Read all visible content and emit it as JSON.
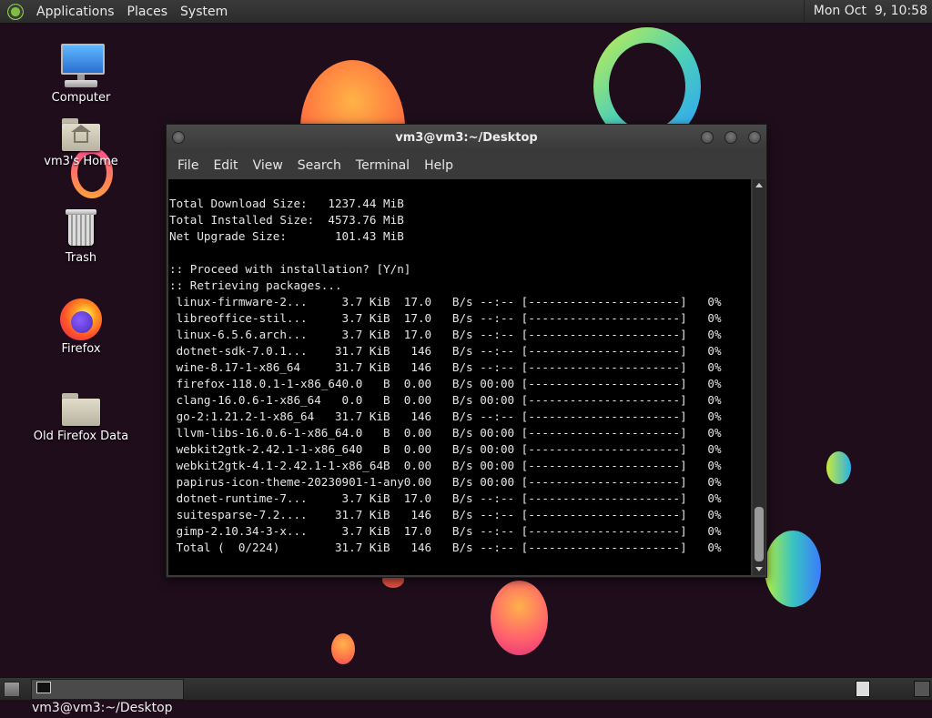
{
  "top_panel": {
    "menus": [
      "Applications",
      "Places",
      "System"
    ],
    "clock": "Mon Oct  9, 10:58",
    "logo_icon": "mate-logo-icon"
  },
  "desktop": {
    "icons": [
      {
        "label": "Computer",
        "icon": "computer-icon"
      },
      {
        "label": "vm3's Home",
        "icon": "home-folder-icon"
      },
      {
        "label": "Trash",
        "icon": "trash-icon"
      },
      {
        "label": "Firefox",
        "icon": "firefox-icon"
      },
      {
        "label": "Old Firefox Data",
        "icon": "folder-icon"
      }
    ]
  },
  "terminal": {
    "title": "vm3@vm3:~/Desktop",
    "menus": [
      "File",
      "Edit",
      "View",
      "Search",
      "Terminal",
      "Help"
    ],
    "lines": [
      "Total Download Size:   1237.44 MiB",
      "Total Installed Size:  4573.76 MiB",
      "Net Upgrade Size:       101.43 MiB",
      "",
      ":: Proceed with installation? [Y/n]",
      ":: Retrieving packages...",
      " linux-firmware-2...     3.7 KiB  17.0   B/s --:-- [----------------------]   0%",
      " libreoffice-stil...     3.7 KiB  17.0   B/s --:-- [----------------------]   0%",
      " linux-6.5.6.arch...     3.7 KiB  17.0   B/s --:-- [----------------------]   0%",
      " dotnet-sdk-7.0.1...    31.7 KiB   146   B/s --:-- [----------------------]   0%",
      " wine-8.17-1-x86_64     31.7 KiB   146   B/s --:-- [----------------------]   0%",
      " firefox-118.0.1-1-x86_640.0   B  0.00   B/s 00:00 [----------------------]   0%",
      " clang-16.0.6-1-x86_64   0.0   B  0.00   B/s 00:00 [----------------------]   0%",
      " go-2:1.21.2-1-x86_64   31.7 KiB   146   B/s --:-- [----------------------]   0%",
      " llvm-libs-16.0.6-1-x86_64.0   B  0.00   B/s 00:00 [----------------------]   0%",
      " webkit2gtk-2.42.1-1-x86_640   B  0.00   B/s 00:00 [----------------------]   0%",
      " webkit2gtk-4.1-2.42.1-1-x86_64B  0.00   B/s 00:00 [----------------------]   0%",
      " papirus-icon-theme-20230901-1-any0.00   B/s 00:00 [----------------------]   0%",
      " dotnet-runtime-7...     3.7 KiB  17.0   B/s --:-- [----------------------]   0%",
      " suitesparse-7.2....    31.7 KiB   146   B/s --:-- [----------------------]   0%",
      " gimp-2.10.34-3-x...     3.7 KiB  17.0   B/s --:-- [----------------------]   0%",
      " Total (  0/224)        31.7 KiB   146   B/s --:-- [----------------------]   0%"
    ]
  },
  "taskbar": {
    "task_label": "vm3@vm3:~/Desktop"
  }
}
